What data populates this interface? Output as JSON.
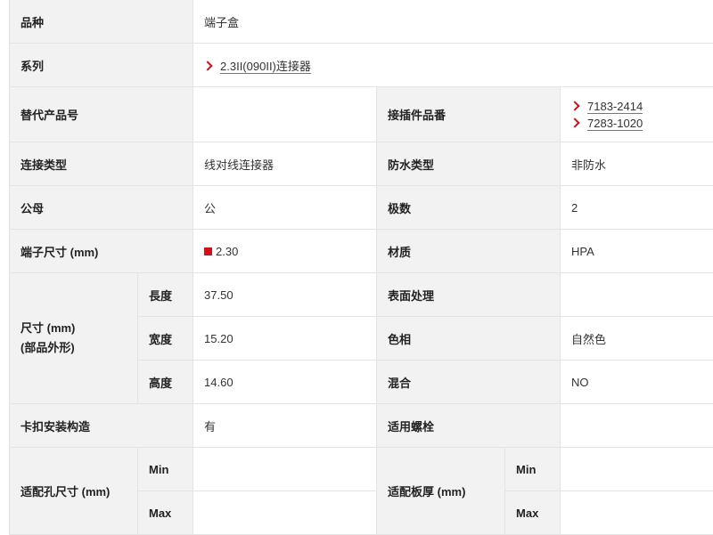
{
  "rows": {
    "variety": {
      "label": "品种",
      "value": "端子盒"
    },
    "series": {
      "label": "系列",
      "link": "2.3II(090II)连接器"
    },
    "alt_part": {
      "label": "替代产品号",
      "value": ""
    },
    "mating_part": {
      "label": "接插件品番",
      "links": [
        "7183-2414",
        "7283-1020"
      ]
    },
    "connection_type": {
      "label": "连接类型",
      "value": "线对线连接器"
    },
    "waterproof_type": {
      "label": "防水类型",
      "value": "非防水"
    },
    "gender": {
      "label": "公母",
      "value": "公"
    },
    "poles": {
      "label": "极数",
      "value": "2"
    },
    "terminal_size": {
      "label": "端子尺寸 (mm)",
      "value": "2.30",
      "color": "#d0101a"
    },
    "material": {
      "label": "材质",
      "value": "HPA"
    },
    "dimensions": {
      "label_line1": "尺寸 (mm)",
      "label_line2": "(部品外形)",
      "length": {
        "label": "長度",
        "value": "37.50"
      },
      "width": {
        "label": "宽度",
        "value": "15.20"
      },
      "height": {
        "label": "高度",
        "value": "14.60"
      }
    },
    "surface_treatment": {
      "label": "表面处理",
      "value": ""
    },
    "color": {
      "label": "色相",
      "value": "自然色"
    },
    "mixing": {
      "label": "混合",
      "value": "NO"
    },
    "snap_structure": {
      "label": "卡扣安装构造",
      "value": "有"
    },
    "bolt": {
      "label": "适用螺栓",
      "value": ""
    },
    "hole_size": {
      "label": "适配孔尺寸 (mm)",
      "min_label": "Min",
      "max_label": "Max",
      "min_value": "",
      "max_value": ""
    },
    "panel_thickness": {
      "label": "适配板厚 (mm)",
      "min_label": "Min",
      "max_label": "Max",
      "min_value": "",
      "max_value": ""
    }
  },
  "colors": {
    "accent": "#d0101a",
    "label_bg": "#f2f2f2",
    "border": "#e4e4e4"
  },
  "icons": {
    "link_arrow": "chevron-right-icon",
    "color_swatch": "red-square-icon"
  }
}
